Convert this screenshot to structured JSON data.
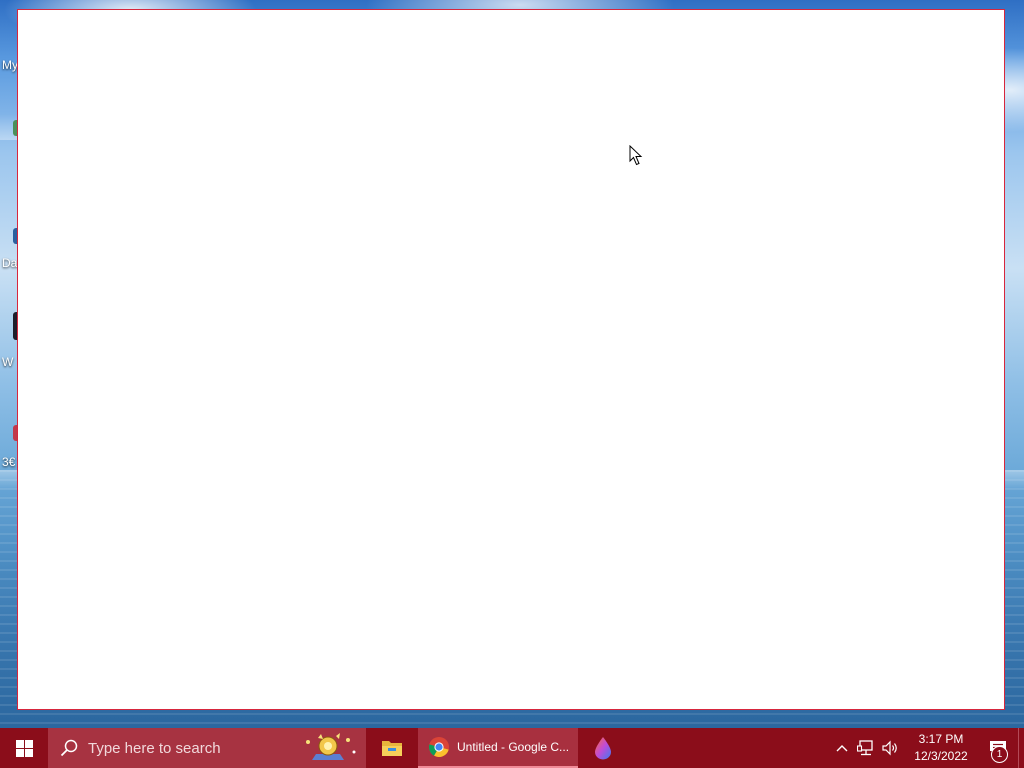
{
  "desktop": {
    "icons": [
      {
        "label": "My",
        "icon": "my-computer-icon"
      },
      {
        "label": "Da",
        "icon": "app-icon"
      },
      {
        "label": "W",
        "icon": "app-icon"
      },
      {
        "label": "3€",
        "icon": "app-icon"
      }
    ]
  },
  "window": {
    "content": "",
    "border_color": "#d7263d"
  },
  "taskbar": {
    "background": "#8b0d1a",
    "search": {
      "placeholder": "Type here to search"
    },
    "pinned": [
      {
        "name": "File Explorer",
        "icon": "folder-icon"
      },
      {
        "name": "Google Chrome",
        "icon": "chrome-icon",
        "label": "Untitled - Google C...",
        "active": true
      },
      {
        "name": "Drop app",
        "icon": "drop-icon"
      }
    ],
    "tray": {
      "time": "3:17 PM",
      "date": "12/3/2022",
      "notification_count": "1"
    }
  }
}
